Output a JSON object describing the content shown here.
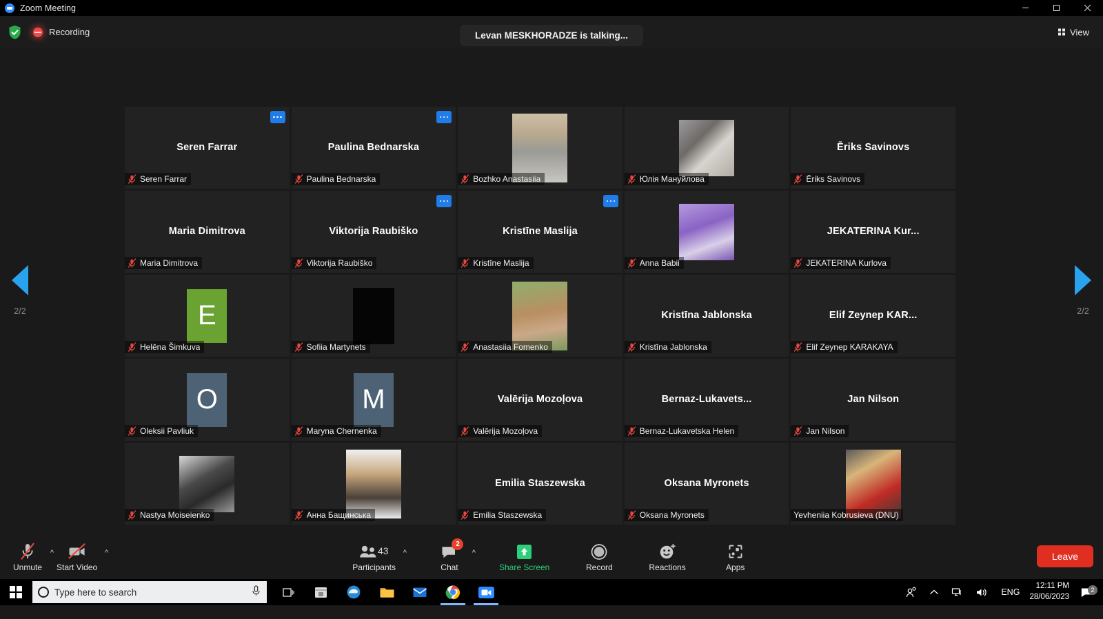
{
  "window": {
    "title": "Zoom Meeting",
    "app_icon": "zoom-logo-icon",
    "minimize_label": "Minimize",
    "maximize_label": "Restore",
    "close_label": "Close"
  },
  "header": {
    "encryption_icon": "shield-check-icon",
    "recording_icon": "recording-dot-icon",
    "recording_label": "Recording",
    "talking_banner": "Levan MESKHORADZE is talking...",
    "view_label": "View",
    "view_icon": "grid-view-icon"
  },
  "pager": {
    "left_icon": "chevron-left-page-icon",
    "right_icon": "chevron-right-page-icon",
    "left_label": "2/2",
    "right_label": "2/2"
  },
  "colors": {
    "accent_blue": "#1f7ce8",
    "leave_red": "#e02e20",
    "share_green": "#2dd07a",
    "mute_red": "#e8483f",
    "avatar_green": "#6aa331",
    "avatar_slate": "#4d6375"
  },
  "participants_grid": [
    {
      "display_name": "Seren Farrar",
      "name_label": "Seren Farrar",
      "muted": true,
      "has_more_menu": true,
      "content": "name"
    },
    {
      "display_name": "Paulina Bednarska",
      "name_label": "Paulina Bednarska",
      "muted": true,
      "has_more_menu": true,
      "content": "name"
    },
    {
      "display_name": "Bozhko Anastasiia",
      "name_label": "Bozhko Anastasiia",
      "muted": true,
      "has_more_menu": false,
      "content": "photo",
      "photo": "woman-on-stairs"
    },
    {
      "display_name": "Юлія Мануйлова",
      "name_label": "Юлія Мануйлова",
      "muted": true,
      "has_more_menu": false,
      "content": "photo",
      "photo": "woman-white-shirt"
    },
    {
      "display_name": "Ēriks Savinovs",
      "name_label": "Ēriks Savinovs",
      "muted": true,
      "has_more_menu": false,
      "content": "name"
    },
    {
      "display_name": "Maria Dimitrova",
      "name_label": "Maria Dimitrova",
      "muted": true,
      "has_more_menu": false,
      "content": "name"
    },
    {
      "display_name": "Viktorija Raubiško",
      "name_label": "Viktorija Raubiško",
      "muted": true,
      "has_more_menu": true,
      "content": "name"
    },
    {
      "display_name": "Kristīne Maslija",
      "name_label": "Kristīne Maslija",
      "muted": true,
      "has_more_menu": true,
      "content": "name"
    },
    {
      "display_name": "Anna Babii",
      "name_label": "Anna Babii",
      "muted": true,
      "has_more_menu": false,
      "content": "photo",
      "photo": "woman-purple-bg"
    },
    {
      "display_name": "JEKATERINA  Kur...",
      "name_label": "JEKATERINA Kurlova",
      "muted": true,
      "has_more_menu": false,
      "content": "name"
    },
    {
      "display_name": "Helēna Šimkuva",
      "name_label": "Helēna Šimkuva",
      "muted": true,
      "has_more_menu": false,
      "content": "initial",
      "initial": "E",
      "initial_color": "#6aa331"
    },
    {
      "display_name": "Sofiia Martynets",
      "name_label": "Sofiia Martynets",
      "muted": true,
      "has_more_menu": false,
      "content": "black"
    },
    {
      "display_name": "Anastasiia Fomenko",
      "name_label": "Anastasiia Fomenko",
      "muted": true,
      "has_more_menu": false,
      "content": "photo",
      "photo": "girl-outdoors"
    },
    {
      "display_name": "Kristīna Jablonska",
      "name_label": "Kristīna Jablonska",
      "muted": true,
      "has_more_menu": false,
      "content": "name"
    },
    {
      "display_name": "Elif  Zeynep  KAR...",
      "name_label": "Elif Zeynep KARAKAYA",
      "muted": true,
      "has_more_menu": false,
      "content": "name"
    },
    {
      "display_name": "Oleksii Pavliuk",
      "name_label": "Oleksii Pavliuk",
      "muted": true,
      "has_more_menu": false,
      "content": "initial",
      "initial": "O",
      "initial_color": "#4d6375"
    },
    {
      "display_name": "Maryna Chernenka",
      "name_label": "Maryna Chernenka",
      "muted": true,
      "has_more_menu": false,
      "content": "initial",
      "initial": "M",
      "initial_color": "#4d6375"
    },
    {
      "display_name": "Valērija Mozoļova",
      "name_label": "Valērija Mozoļova",
      "muted": true,
      "has_more_menu": false,
      "content": "name"
    },
    {
      "display_name": "Bernaz-Lukavets...",
      "name_label": "Bernaz-Lukavetska Helen",
      "muted": true,
      "has_more_menu": false,
      "content": "name"
    },
    {
      "display_name": "Jan Nilson",
      "name_label": "Jan Nilson",
      "muted": true,
      "has_more_menu": false,
      "content": "name"
    },
    {
      "display_name": "Nastya Moiseienko",
      "name_label": "Nastya Moiseienko",
      "muted": true,
      "has_more_menu": false,
      "content": "photo",
      "photo": "chimp-newspaper"
    },
    {
      "display_name": "Анна Бащинська",
      "name_label": "Анна Бащинська",
      "muted": true,
      "has_more_menu": false,
      "content": "photo",
      "photo": "woman-portrait-white"
    },
    {
      "display_name": "Emilia Staszewska",
      "name_label": "Emilia Staszewska",
      "muted": true,
      "has_more_menu": false,
      "content": "name"
    },
    {
      "display_name": "Oksana Myronets",
      "name_label": "Oksana Myronets",
      "muted": true,
      "has_more_menu": false,
      "content": "name"
    },
    {
      "display_name": "Yevheniia Kobrusieva (DNU)",
      "name_label": "Yevheniia Kobrusieva (DNU)",
      "muted": false,
      "has_more_menu": false,
      "content": "photo",
      "photo": "woman-red-jacket"
    }
  ],
  "controls": {
    "mute": {
      "label": "Unmute",
      "icon": "microphone-muted-icon",
      "has_caret": true
    },
    "video": {
      "label": "Start Video",
      "icon": "camera-off-icon",
      "has_caret": true
    },
    "participants": {
      "label": "Participants",
      "icon": "participants-icon",
      "count": "43",
      "has_caret": true
    },
    "chat": {
      "label": "Chat",
      "icon": "chat-bubble-icon",
      "badge": "2",
      "has_caret": true
    },
    "share": {
      "label": "Share Screen",
      "icon": "share-screen-up-arrow-icon"
    },
    "record": {
      "label": "Record",
      "icon": "record-circle-icon"
    },
    "reactions": {
      "label": "Reactions",
      "icon": "smiley-plus-icon"
    },
    "apps": {
      "label": "Apps",
      "icon": "apps-brackets-icon"
    },
    "leave": {
      "label": "Leave"
    }
  },
  "taskbar": {
    "start_icon": "windows-start-icon",
    "search_placeholder": "Type here to search",
    "search_icon": "search-circle-icon",
    "mic_icon": "cortana-mic-icon",
    "task_view_icon": "task-view-icon",
    "pinned": [
      {
        "name": "microsoft-store-icon",
        "active": false
      },
      {
        "name": "edge-browser-icon",
        "active": false
      },
      {
        "name": "file-explorer-icon",
        "active": false
      },
      {
        "name": "mail-icon",
        "active": false
      },
      {
        "name": "chrome-browser-icon",
        "active": true
      },
      {
        "name": "zoom-app-icon",
        "active": true,
        "label": "zoom"
      }
    ],
    "tray": {
      "people_icon": "people-share-icon",
      "chevron_icon": "show-hidden-icons-icon",
      "network_icon": "network-icon",
      "volume_icon": "volume-icon",
      "language": "ENG",
      "time": "12:11 PM",
      "date": "28/06/2023",
      "notification_icon": "action-center-icon",
      "notification_count": "2"
    }
  }
}
